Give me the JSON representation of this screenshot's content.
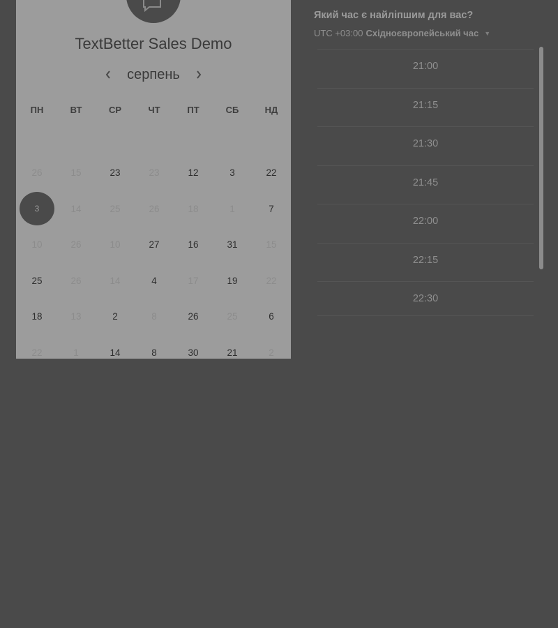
{
  "event": {
    "title": "TextBetter Sales Demo"
  },
  "calendar": {
    "month": "серпень",
    "weekdays": [
      "ПН",
      "ВТ",
      "СР",
      "ЧТ",
      "ПТ",
      "СБ",
      "НД"
    ],
    "rows": [
      [
        {
          "d": "26",
          "a": false
        },
        {
          "d": "15",
          "a": false
        },
        {
          "d": "23",
          "a": true
        },
        {
          "d": "23",
          "a": false
        },
        {
          "d": "12",
          "a": true
        },
        {
          "d": "3",
          "a": true
        },
        {
          "d": "22",
          "a": true
        }
      ],
      [
        {
          "d": "3",
          "a": true,
          "sel": true
        },
        {
          "d": "14",
          "a": false
        },
        {
          "d": "25",
          "a": false
        },
        {
          "d": "26",
          "a": false
        },
        {
          "d": "18",
          "a": false
        },
        {
          "d": "1",
          "a": false
        },
        {
          "d": "7",
          "a": true
        }
      ],
      [
        {
          "d": "10",
          "a": false
        },
        {
          "d": "26",
          "a": false
        },
        {
          "d": "10",
          "a": false
        },
        {
          "d": "27",
          "a": true
        },
        {
          "d": "16",
          "a": true
        },
        {
          "d": "31",
          "a": true
        },
        {
          "d": "15",
          "a": false
        }
      ],
      [
        {
          "d": "25",
          "a": true
        },
        {
          "d": "26",
          "a": false
        },
        {
          "d": "14",
          "a": false
        },
        {
          "d": "4",
          "a": true
        },
        {
          "d": "17",
          "a": false
        },
        {
          "d": "19",
          "a": true
        },
        {
          "d": "22",
          "a": false
        }
      ],
      [
        {
          "d": "18",
          "a": true
        },
        {
          "d": "13",
          "a": false
        },
        {
          "d": "2",
          "a": true
        },
        {
          "d": "8",
          "a": false
        },
        {
          "d": "26",
          "a": true
        },
        {
          "d": "25",
          "a": false
        },
        {
          "d": "6",
          "a": true
        }
      ],
      [
        {
          "d": "22",
          "a": false
        },
        {
          "d": "1",
          "a": false
        },
        {
          "d": "14",
          "a": true
        },
        {
          "d": "8",
          "a": true
        },
        {
          "d": "30",
          "a": true
        },
        {
          "d": "21",
          "a": true
        },
        {
          "d": "2",
          "a": false
        }
      ]
    ]
  },
  "scheduler": {
    "question": "Який час є найліпшим для вас?",
    "timezone_offset": "UTC +03:00",
    "timezone_name": "Східноєвропейський час",
    "slots": [
      "21:00",
      "21:15",
      "21:30",
      "21:45",
      "22:00",
      "22:15",
      "22:30"
    ]
  }
}
